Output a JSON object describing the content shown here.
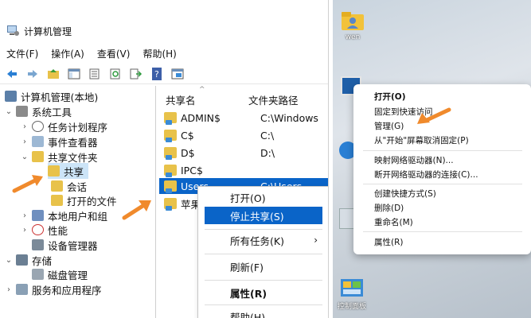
{
  "window": {
    "title": "计算机管理",
    "menu": [
      "文件(F)",
      "操作(A)",
      "查看(V)",
      "帮助(H)"
    ]
  },
  "tree": {
    "root": "计算机管理(本地)",
    "system_tools": "系统工具",
    "task_scheduler": "任务计划程序",
    "event_viewer": "事件查看器",
    "shared_folders": "共享文件夹",
    "shares": "共享",
    "sessions": "会话",
    "open_files": "打开的文件",
    "local_users": "本地用户和组",
    "performance": "性能",
    "device_manager": "设备管理器",
    "storage": "存储",
    "disk_management": "磁盘管理",
    "services_apps": "服务和应用程序"
  },
  "list": {
    "col_share": "共享名",
    "col_path": "文件夹路径",
    "rows": [
      {
        "name": "ADMIN$",
        "path": "C:\\Windows"
      },
      {
        "name": "C$",
        "path": "C:\\"
      },
      {
        "name": "D$",
        "path": "D:\\"
      },
      {
        "name": "IPC$",
        "path": ""
      },
      {
        "name": "Users",
        "path": "C:\\Users"
      },
      {
        "name": "苹果",
        "path": ""
      }
    ]
  },
  "ctx_left": {
    "open": "打开(O)",
    "stop_share": "停止共享(S)",
    "all_tasks": "所有任务(K)",
    "refresh": "刷新(F)",
    "properties": "属性(R)",
    "help": "帮助(H)"
  },
  "desktop": {
    "user_icon_label": "wen",
    "control_panel_label": "控制面板"
  },
  "ctx_right": {
    "items": [
      "打开(O)",
      "固定到快速访问",
      "管理(G)",
      "从\"开始\"屏幕取消固定(P)",
      "映射网络驱动器(N)...",
      "断开网络驱动器的连接(C)...",
      "创建快捷方式(S)",
      "删除(D)",
      "重命名(M)",
      "属性(R)"
    ]
  },
  "colors": {
    "selection": "#0a64c8",
    "arrow": "#f08a2c"
  }
}
